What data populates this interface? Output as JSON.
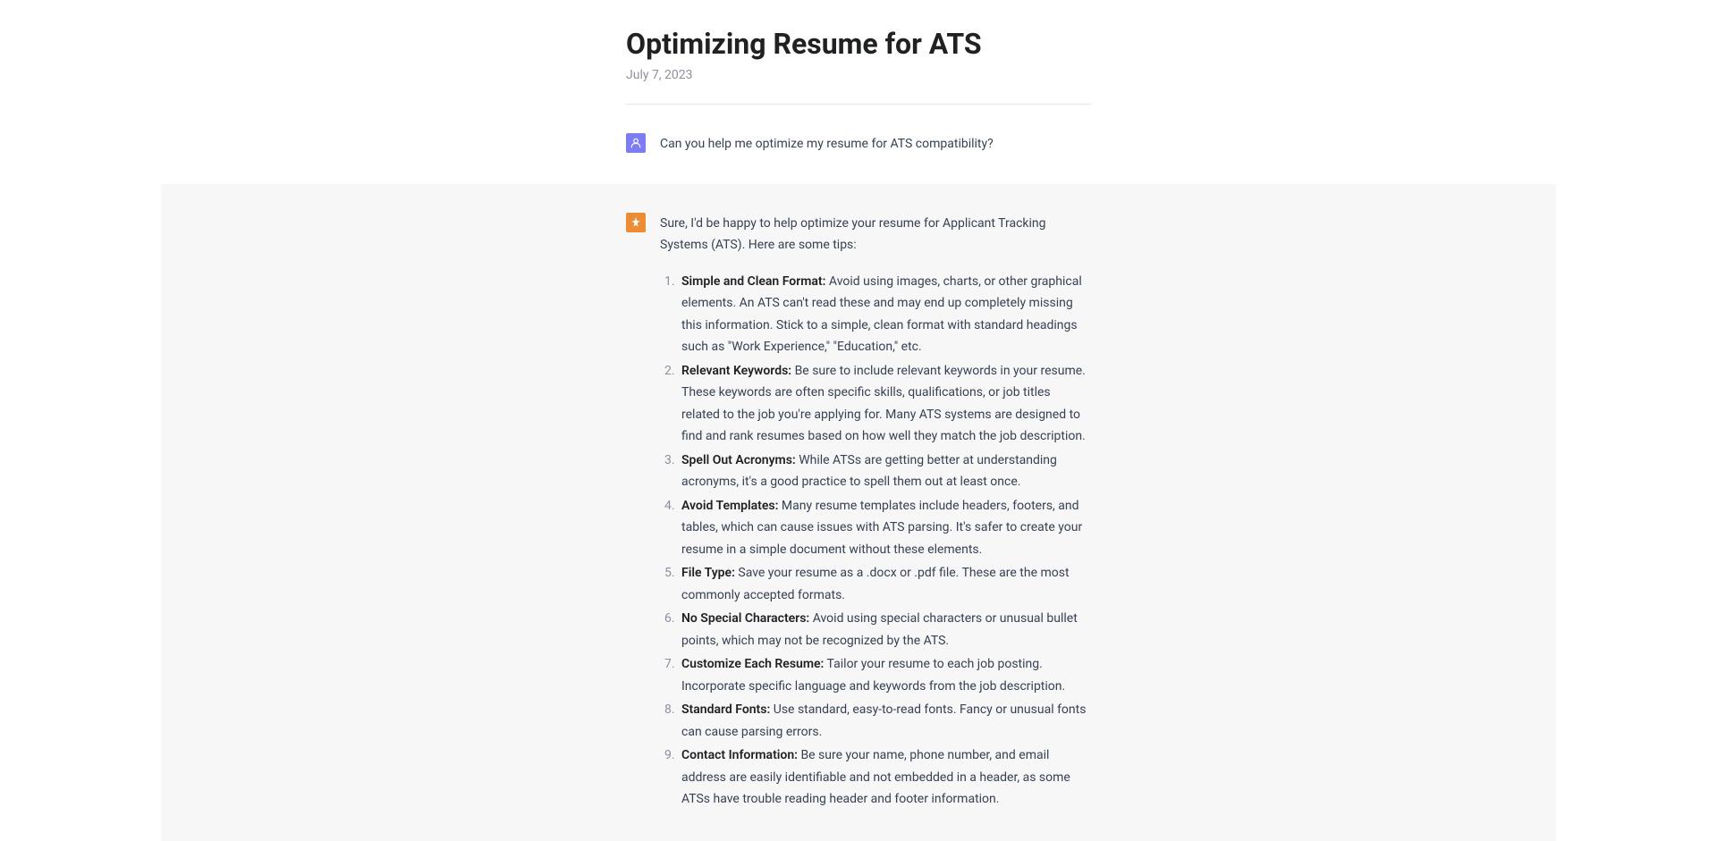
{
  "header": {
    "title": "Optimizing Resume for ATS",
    "date": "July 7, 2023"
  },
  "messages": {
    "user_message": "Can you help me optimize my resume for ATS compatibility?",
    "assistant_intro": "Sure, I'd be happy to help optimize your resume for Applicant Tracking Systems (ATS). Here are some tips:",
    "tips": [
      {
        "label": "Simple and Clean Format:",
        "text": " Avoid using images, charts, or other graphical elements. An ATS can't read these and may end up completely missing this information. Stick to a simple, clean format with standard headings such as \"Work Experience,\" \"Education,\" etc."
      },
      {
        "label": "Relevant Keywords:",
        "text": " Be sure to include relevant keywords in your resume. These keywords are often specific skills, qualifications, or job titles related to the job you're applying for. Many ATS systems are designed to find and rank resumes based on how well they match the job description."
      },
      {
        "label": "Spell Out Acronyms:",
        "text": " While ATSs are getting better at understanding acronyms, it's a good practice to spell them out at least once."
      },
      {
        "label": "Avoid Templates:",
        "text": " Many resume templates include headers, footers, and tables, which can cause issues with ATS parsing. It's safer to create your resume in a simple document without these elements."
      },
      {
        "label": "File Type:",
        "text": " Save your resume as a .docx or .pdf file. These are the most commonly accepted formats."
      },
      {
        "label": "No Special Characters:",
        "text": " Avoid using special characters or unusual bullet points, which may not be recognized by the ATS."
      },
      {
        "label": "Customize Each Resume:",
        "text": " Tailor your resume to each job posting. Incorporate specific language and keywords from the job description."
      },
      {
        "label": "Standard Fonts:",
        "text": " Use standard, easy-to-read fonts. Fancy or unusual fonts can cause parsing errors."
      },
      {
        "label": "Contact Information:",
        "text": " Be sure your name, phone number, and email address are easily identifiable and not embedded in a header, as some ATSs have trouble reading header and footer information."
      }
    ]
  }
}
